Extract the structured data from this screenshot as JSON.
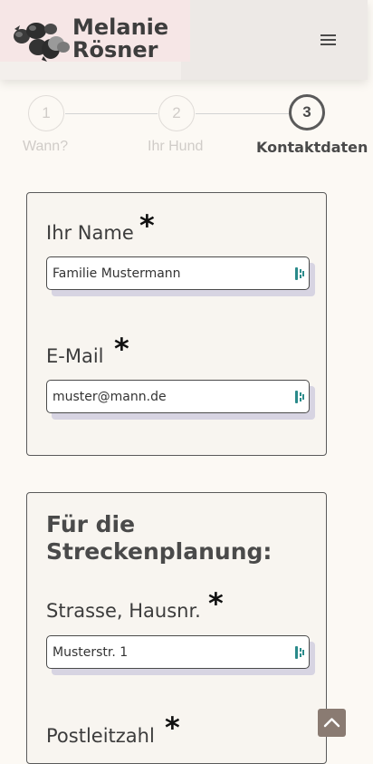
{
  "header": {
    "logo_line1": "Melanie",
    "logo_line2": "Rösner",
    "menu_icon": "hamburger-icon"
  },
  "stepper": {
    "steps": [
      {
        "number": "1",
        "label": "Wann?"
      },
      {
        "number": "2",
        "label": "Ihr Hund"
      },
      {
        "number": "3",
        "label": "Kontaktdaten"
      }
    ],
    "active_step": 3
  },
  "contact_card": {
    "name_label": "Ihr Name",
    "name_required": "*",
    "name_value": "Familie Mustermann",
    "email_label": "E-Mail",
    "email_required": "*",
    "email_value": "muster@mann.de"
  },
  "route_card": {
    "title_line1": "Für die",
    "title_line2": "Streckenplanung:",
    "street_label": "Strasse, Hausnr.",
    "street_required": "*",
    "street_value": "Musterstr. 1",
    "zip_label": "Postleitzahl",
    "zip_required": "*"
  },
  "colors": {
    "background": "#fcf9f4",
    "accent": "#8a7b72",
    "text": "#3c3c3c",
    "input_icon": "#2a8a8a"
  },
  "icons": {
    "input_autofill": "password-manager-icon",
    "scroll_top": "chevron-up-icon"
  }
}
